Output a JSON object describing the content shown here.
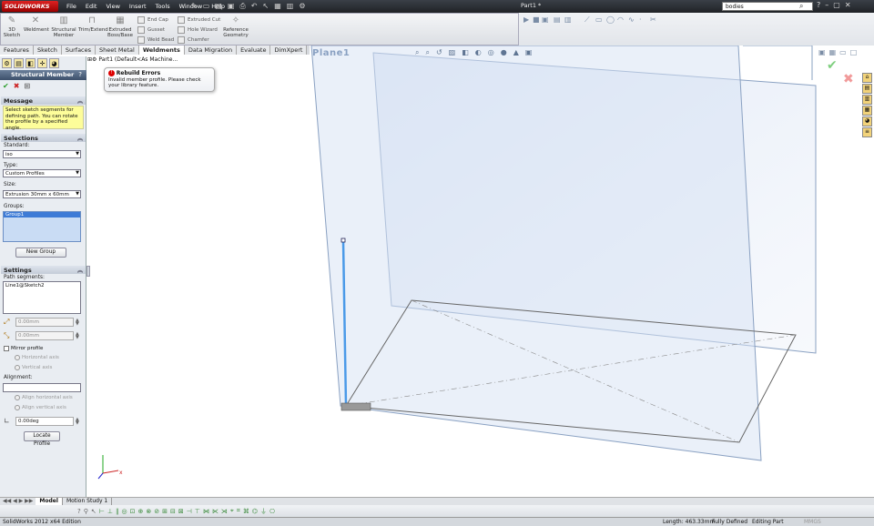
{
  "app": {
    "logo_text": "SOLIDWORKS",
    "menus": [
      "File",
      "Edit",
      "View",
      "Insert",
      "Tools",
      "Window",
      "Help"
    ],
    "doc_title": "Part1 *",
    "search_value": "bodies",
    "window_controls": [
      "?",
      "–",
      "▢",
      "✕"
    ]
  },
  "command_manager": {
    "large": [
      {
        "label": "3D Sketch",
        "icon": "sketch-3d-icon"
      },
      {
        "label": "Weldment",
        "icon": "weldment-icon"
      },
      {
        "label": "Structural Member",
        "icon": "structural-member-icon"
      },
      {
        "label": "Trim/Extend",
        "icon": "trim-extend-icon"
      },
      {
        "label": "Extruded Boss/Base",
        "icon": "extruded-boss-icon"
      }
    ],
    "small_col1": [
      "End Cap",
      "Gusset",
      "Weld Bead"
    ],
    "small_col2": [
      "Extruded Cut",
      "Hole Wizard",
      "Chamfer"
    ],
    "reference": "Reference Geometry"
  },
  "tabs": [
    "Features",
    "Sketch",
    "Surfaces",
    "Sheet Metal",
    "Weldments",
    "Data Migration",
    "Evaluate",
    "DimXpert"
  ],
  "active_tab": "Weldments",
  "property_manager": {
    "title": "Structural Member",
    "help": "?",
    "ok": "✔",
    "cancel": "✖",
    "pin": "⊞",
    "message": {
      "heading": "Message",
      "text": "Select sketch segments for defining path. You can rotate the profile by a specified angle."
    },
    "selections": {
      "heading": "Selections",
      "standard_label": "Standard:",
      "standard_value": "iso",
      "type_label": "Type:",
      "type_value": "Custom Profiles",
      "size_label": "Size:",
      "size_value": "Extrusion 30mm x 60mm",
      "groups_label": "Groups:",
      "groups": [
        "Group1"
      ],
      "new_group": "New Group"
    },
    "settings": {
      "heading": "Settings",
      "path_label": "Path segments:",
      "path_items": [
        "Line1@Sketch2"
      ],
      "field1": "0.00mm",
      "field2": "0.00mm",
      "mirror_profile": "Mirror profile",
      "horizontal_axis": "Horizontal axis",
      "vertical_axis": "Vertical axis",
      "alignment_label": "Alignment:",
      "align_horizontal": "Align horizontal axis",
      "align_vertical": "Align vertical axis",
      "angle": "0.00deg",
      "locate_profile": "Locate Profile"
    }
  },
  "tree": {
    "item": "Part1  (Default<As Machine..."
  },
  "tooltip": {
    "title": "Rebuild Errors",
    "text": "Invalid member profile. Please check your library feature."
  },
  "viewport": {
    "plane_label": "Plane1"
  },
  "bottom_tabs": [
    "Model",
    "Motion Study 1"
  ],
  "active_bottom_tab": "Model",
  "status": {
    "left": "SolidWorks 2012 x64 Edition",
    "length": "Length: 463.33mm",
    "defined": "Fully Defined",
    "editing": "Editing Part",
    "units": "MMGS"
  }
}
